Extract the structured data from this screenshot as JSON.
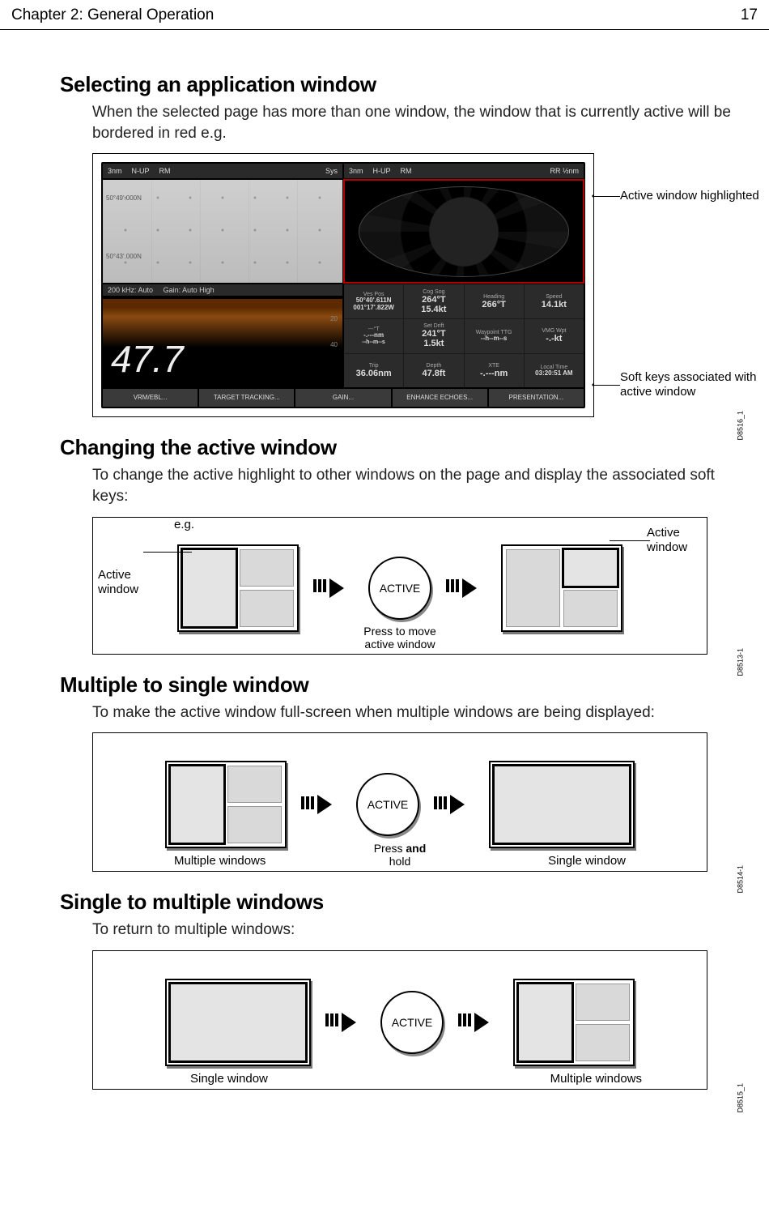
{
  "header": {
    "chapter": "Chapter 2: General Operation",
    "page": "17"
  },
  "sect1": {
    "title": "Selecting an application window",
    "body": "When the selected page has more than one window, the window that is currently active will be bordered in red e.g."
  },
  "fig1": {
    "code": "D8516_1",
    "topbar1": {
      "range": "3nm",
      "orient": "N-UP",
      "mode": "RM",
      "sys": "Sys"
    },
    "topbar2": {
      "range": "3nm",
      "orient": "H-UP",
      "mode": "RM",
      "rr": "RR ½nm"
    },
    "chart": {
      "lat1": "50°49'.000N",
      "lat2": "50°43'.000N"
    },
    "sonar": {
      "head_freq": "200 kHz: Auto",
      "head_gain": "Gain: Auto High",
      "scale20": "20",
      "scale40": "40",
      "depth": "47.7"
    },
    "data": {
      "vespos_lbl": "Ves Pos",
      "vespos_val1": "50°40'.611N",
      "vespos_val2": "001°17'.822W",
      "cogsog_lbl": "Cog Sog",
      "cogsog_val1": "264°T",
      "cogsog_val2": "15.4kt",
      "heading_lbl": "Heading",
      "heading_val": "266°T",
      "speed_lbl": "Speed",
      "speed_val": "14.1kt",
      "wpttg_lbl": "Waypoint TTG",
      "wpttg_val": "--h--m--s",
      "vmg_lbl": "VMG Wpt",
      "vmg_val": "-.-kt",
      "setdrift_lbl": "Set Drift",
      "setdrift_val1": "241°T",
      "setdrift_val2": "1.5kt",
      "depth_lbl": "Depth",
      "depth_val": "47.8ft",
      "xte_lbl": "XTE",
      "xte_val": "-.---nm",
      "trip_lbl": "Trip",
      "trip_val": "36.06nm",
      "time_lbl": "Local Time",
      "time_val": "03:20:51 AM",
      "hms_lbl": "--h--m--s",
      "blank1_lbl": "---°T",
      "blank1_val": "-.---nm"
    },
    "softkeys": {
      "k1": "VRM/EBL...",
      "k2": "TARGET TRACKING...",
      "k3": "GAIN...",
      "k4": "ENHANCE ECHOES...",
      "k5": "PRESENTATION..."
    },
    "callout1": "Active window highlighted",
    "callout2": "Soft keys associated with active window"
  },
  "sect2": {
    "title": "Changing the active window",
    "body": "To change the active highlight to other windows on the page and display the associated soft keys:"
  },
  "fig2": {
    "code": "D8513-1",
    "eg": "e.g.",
    "active_left": "Active window",
    "active_right": "Active window",
    "button": "ACTIVE",
    "press": "Press to move active window"
  },
  "sect3": {
    "title": "Multiple to single window",
    "body": "To make the active window full-screen when multiple windows are being displayed:"
  },
  "fig3": {
    "code": "D8514-1",
    "left": "Multiple windows",
    "right": "Single window",
    "button": "ACTIVE",
    "press_a": "Press ",
    "press_b": "and",
    "press_c": " hold"
  },
  "sect4": {
    "title": "Single to multiple windows",
    "body": "To return to multiple windows:"
  },
  "fig4": {
    "code": "D8515_1",
    "left": "Single window",
    "right": "Multiple windows",
    "button": "ACTIVE"
  }
}
